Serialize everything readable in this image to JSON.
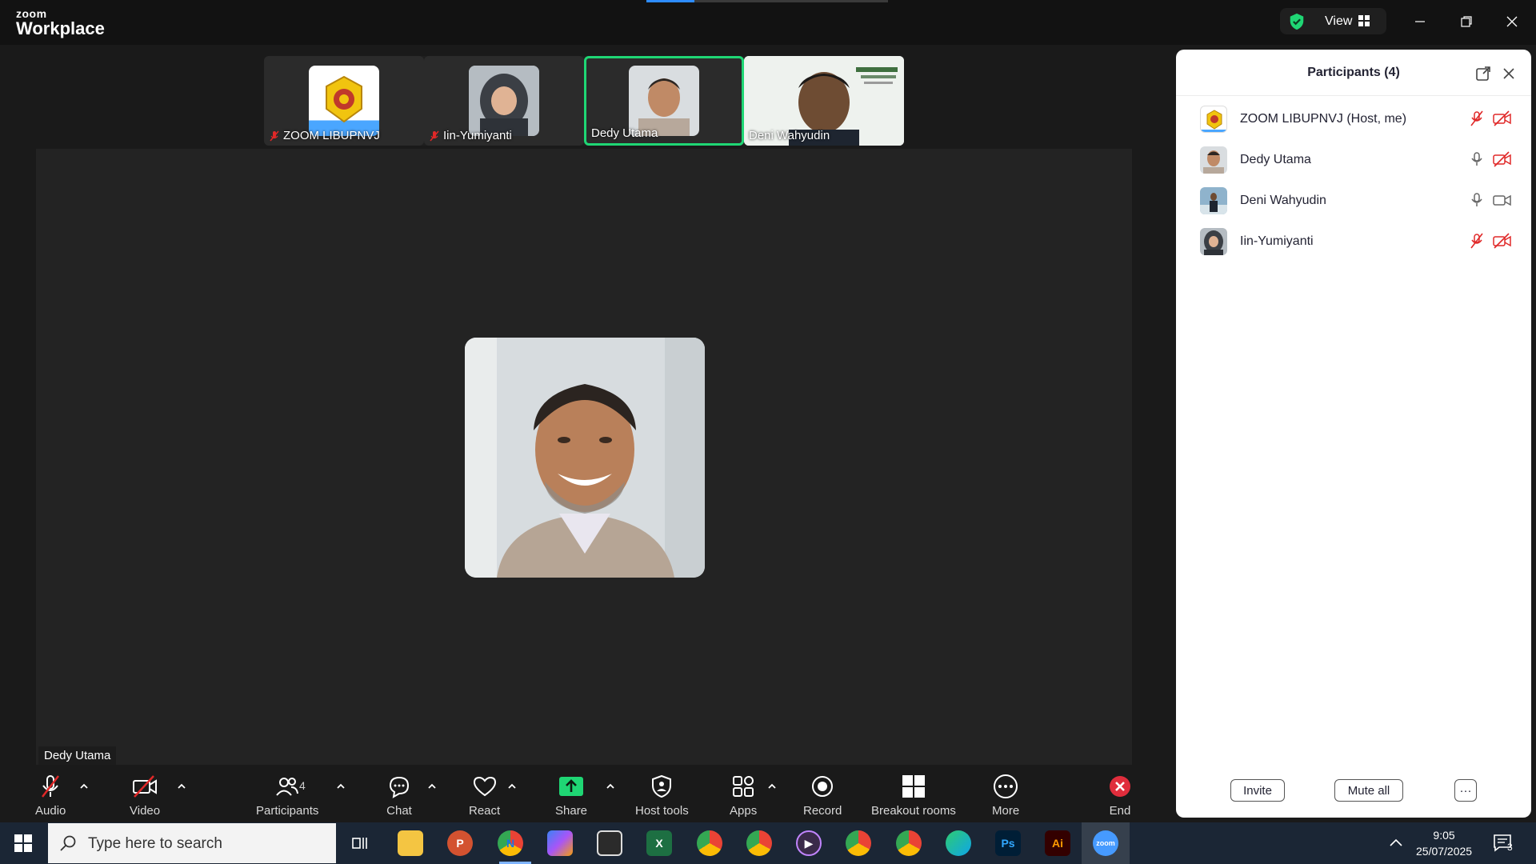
{
  "app": {
    "logo_top": "zoom",
    "logo_bottom": "Workplace",
    "view_label": "View"
  },
  "filmstrip": [
    {
      "name": "ZOOM LIBUPNVJ",
      "muted": true
    },
    {
      "name": "Iin-Yumiyanti",
      "muted": true
    },
    {
      "name": "Dedy Utama",
      "muted": false,
      "active": true
    },
    {
      "name": "Deni Wahyudin",
      "muted": false
    }
  ],
  "stage": {
    "speaker_name": "Dedy Utama"
  },
  "toolbar": {
    "audio": "Audio",
    "video": "Video",
    "participants": "Participants",
    "participants_count": "4",
    "chat": "Chat",
    "react": "React",
    "share": "Share",
    "host_tools": "Host tools",
    "apps": "Apps",
    "record": "Record",
    "breakout": "Breakout rooms",
    "more": "More",
    "end": "End"
  },
  "panel": {
    "title": "Participants (4)",
    "participants": [
      {
        "name": "ZOOM LIBUPNVJ (Host, me)",
        "mic": "muted",
        "cam": "off"
      },
      {
        "name": "Dedy Utama",
        "mic": "on",
        "cam": "off"
      },
      {
        "name": "Deni Wahyudin",
        "mic": "on",
        "cam": "on"
      },
      {
        "name": "Iin-Yumiyanti",
        "mic": "muted",
        "cam": "off"
      }
    ],
    "invite": "Invite",
    "mute_all": "Mute all",
    "more": "···"
  },
  "taskbar": {
    "search_placeholder": "Type here to search",
    "time": "9:05",
    "date": "25/07/2025",
    "notifications": "3",
    "apps": [
      "file-explorer",
      "powerpoint",
      "chrome-n",
      "copilot",
      "store",
      "excel",
      "chrome-fp",
      "chrome-s",
      "media-player",
      "chrome",
      "chrome-profile",
      "edge",
      "photoshop",
      "illustrator",
      "zoom"
    ]
  },
  "colors": {
    "accent_green": "#1fd674",
    "zoom_blue": "#2d8cff",
    "muted_red": "#e02828",
    "end_red": "#e02d3c"
  }
}
